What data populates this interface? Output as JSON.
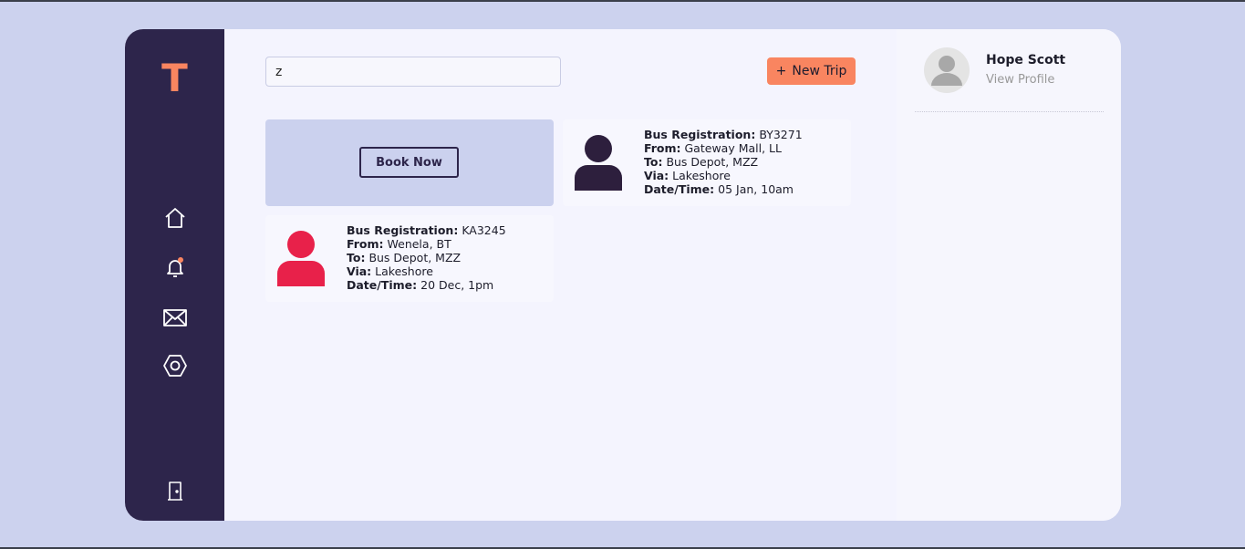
{
  "sidebar": {
    "logo": "T",
    "nav": [
      "home-icon",
      "bell-icon",
      "mail-icon",
      "settings-icon",
      "logout-icon"
    ],
    "notification_dot_color": "#f98560"
  },
  "search": {
    "value": "z",
    "placeholder": ""
  },
  "toolbar": {
    "new_trip_icon": "+",
    "new_trip_label": "New Trip"
  },
  "book_card": {
    "button_label": "Book Now"
  },
  "trips": [
    {
      "avatar_color": "#2d1f3d",
      "reg_label": "Bus Registration:",
      "reg_value": "BY3271",
      "from_label": "From:",
      "from_value": "Gateway Mall, LL",
      "to_label": "To:",
      "to_value": "Bus Depot, MZZ",
      "via_label": "Via:",
      "via_value": "Lakeshore",
      "dt_label": "Date/Time:",
      "dt_value": "05 Jan, 10am"
    },
    {
      "avatar_color": "#e8214a",
      "reg_label": "Bus Registration:",
      "reg_value": "KA3245",
      "from_label": "From:",
      "from_value": "Wenela, BT",
      "to_label": "To:",
      "to_value": "Bus Depot, MZZ",
      "via_label": "Via:",
      "via_value": "Lakeshore",
      "dt_label": "Date/Time:",
      "dt_value": "20 Dec, 1pm"
    }
  ],
  "profile": {
    "name": "Hope Scott",
    "link": "View Profile"
  },
  "colors": {
    "accent": "#f98560",
    "sidebar": "#2d254b",
    "background": "#ccd2ee"
  }
}
